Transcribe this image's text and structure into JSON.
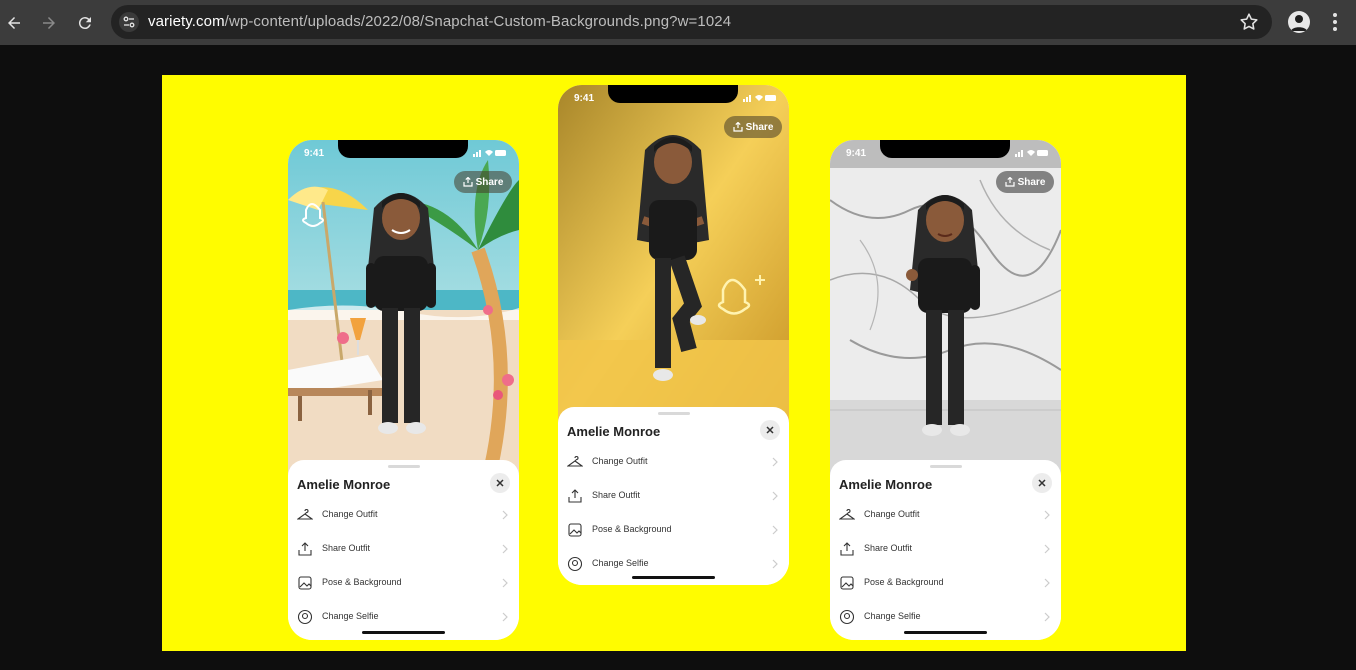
{
  "browser": {
    "url_host": "variety.com",
    "url_path": "/wp-content/uploads/2022/08/Snapchat-Custom-Backgrounds.png?w=1024"
  },
  "phones": [
    {
      "background": "beach",
      "status_time": "9:41",
      "share_label": "Share",
      "profile_name": "Amelie Monroe",
      "menu": [
        "Change Outfit",
        "Share Outfit",
        "Pose & Background",
        "Change Selfie"
      ]
    },
    {
      "background": "gold",
      "status_time": "9:41",
      "share_label": "Share",
      "profile_name": "Amelie Monroe",
      "menu": [
        "Change Outfit",
        "Share Outfit",
        "Pose & Background",
        "Change Selfie"
      ]
    },
    {
      "background": "marble",
      "status_time": "9:41",
      "share_label": "Share",
      "profile_name": "Amelie Monroe",
      "menu": [
        "Change Outfit",
        "Share Outfit",
        "Pose & Background",
        "Change Selfie"
      ]
    }
  ],
  "colors": {
    "snapchat_yellow": "#fffc00",
    "chrome_bg": "#3c3c3c",
    "omnibox_bg": "#232323"
  }
}
